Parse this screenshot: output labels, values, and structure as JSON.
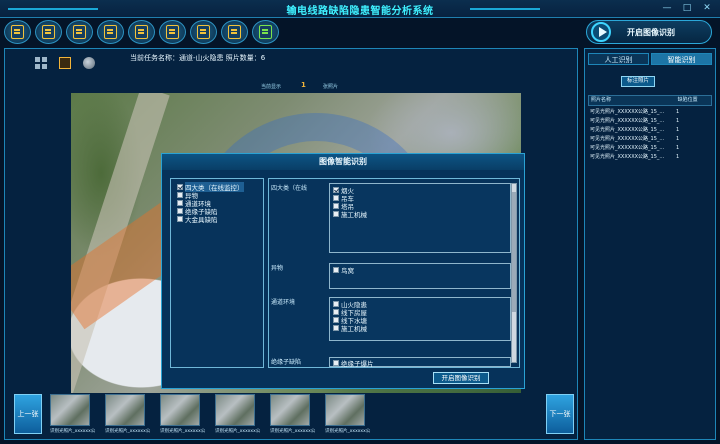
{
  "app": {
    "title": "输电线路缺陷隐患智能分析系统"
  },
  "window": {
    "minimize": "—",
    "maximize": "□",
    "close": "✕"
  },
  "toolbar": {
    "items": [
      "folder",
      "book",
      "image",
      "image-edit",
      "chart",
      "document",
      "printer",
      "export",
      "export-green"
    ]
  },
  "start_button": {
    "label": "开启图像识别"
  },
  "task": {
    "label": "当前任务名称：通道-山火隐患 照片数量：6"
  },
  "sub_info": {
    "current_label": "当前显示",
    "current_value": "1",
    "second_label": "张照片"
  },
  "dialog": {
    "title": "图像智能识别",
    "left_items": [
      {
        "label": "四大类（在线监控）",
        "checked": true,
        "selected": true
      },
      {
        "label": "异物",
        "checked": false
      },
      {
        "label": "通道环境",
        "checked": false
      },
      {
        "label": "绝缘子缺陷",
        "checked": false
      },
      {
        "label": "大金具缺陷",
        "checked": false
      }
    ],
    "sections": [
      {
        "label": "四大类（在线",
        "items": [
          {
            "label": "烟火",
            "checked": true
          },
          {
            "label": "吊车",
            "checked": false
          },
          {
            "label": "塔吊",
            "checked": false
          },
          {
            "label": "施工机械",
            "checked": false
          }
        ]
      },
      {
        "label": "异物",
        "items": [
          {
            "label": "鸟窝",
            "checked": false
          }
        ]
      },
      {
        "label": "通道环境",
        "items": [
          {
            "label": "山火隐患",
            "checked": false
          },
          {
            "label": "线下房屋",
            "checked": false
          },
          {
            "label": "线下水塘",
            "checked": false
          },
          {
            "label": "施工机械",
            "checked": false
          }
        ]
      },
      {
        "label": "绝缘子缺陷",
        "items": [
          {
            "label": "绝缘子爆片",
            "checked": false
          }
        ]
      }
    ],
    "action_button": "开启图像识别"
  },
  "thumbnails": {
    "prev": "上一张",
    "next": "下一张",
    "captions": [
      "识别光照片_xxxxxx公",
      "识别光照片_xxxxxx公",
      "识别光照片_xxxxxx公",
      "识别光照片_xxxxxx公",
      "识别光照片_xxxxxx公",
      "识别光照片_xxxxxx公"
    ]
  },
  "right_panel": {
    "tabs": [
      "人工识别",
      "智能识别"
    ],
    "tag_button": "标注照片",
    "columns": [
      "照片名称",
      "缺陷位置"
    ],
    "rows": [
      {
        "name": "可见光照片_XXXXXX公路_15_...",
        "value": "1"
      },
      {
        "name": "可见光照片_XXXXXX公路_15_...",
        "value": "1"
      },
      {
        "name": "可见光照片_XXXXXX公路_15_...",
        "value": "1"
      },
      {
        "name": "可见光照片_XXXXXX公路_15_...",
        "value": "1"
      },
      {
        "name": "可见光照片_XXXXXX公路_15_...",
        "value": "1"
      },
      {
        "name": "可见光照片_XXXXXX公路_15_...",
        "value": "1"
      }
    ]
  },
  "colors": {
    "accent": "#3ff1ff",
    "panel": "#052240",
    "border": "#1e86b8",
    "highlight": "#f2b43a"
  }
}
